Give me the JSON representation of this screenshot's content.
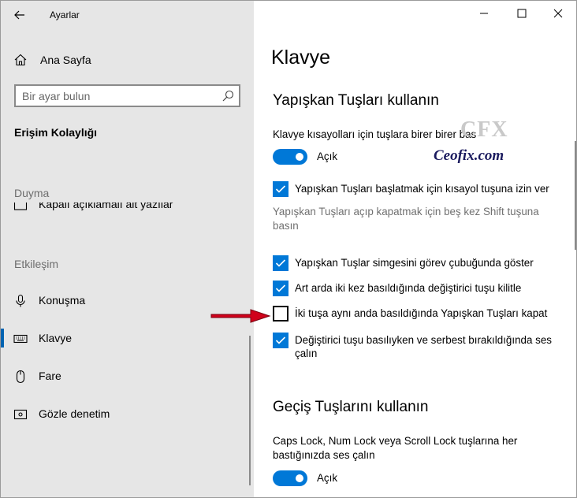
{
  "window": {
    "title": "Ayarlar"
  },
  "sidebar": {
    "home_label": "Ana Sayfa",
    "search_placeholder": "Bir ayar bulun",
    "category": "Erişim Kolaylığı",
    "sections": [
      {
        "label": "Duyma"
      },
      {
        "label": "Etkileşim"
      }
    ],
    "clipped_item": "Kapalı açıklamalı alt yazılar",
    "items": [
      {
        "label": "Konuşma",
        "icon": "microphone-icon"
      },
      {
        "label": "Klavye",
        "icon": "keyboard-icon",
        "active": true
      },
      {
        "label": "Fare",
        "icon": "mouse-icon"
      },
      {
        "label": "Gözle denetim",
        "icon": "eye-control-icon"
      }
    ]
  },
  "main": {
    "page_title": "Klavye",
    "sticky_keys": {
      "heading": "Yapışkan Tuşları kullanın",
      "description": "Klavye kısayolları için tuşlara birer birer bas",
      "toggle_label": "Açık",
      "shortcut_check": "Yapışkan Tuşları başlatmak için kısayol tuşuna izin ver",
      "shortcut_help": "Yapışkan Tuşları açıp kapatmak için beş kez Shift tuşuna basın",
      "options": [
        {
          "label": "Yapışkan Tuşlar simgesini görev çubuğunda göster",
          "checked": true
        },
        {
          "label": "Art arda iki kez basıldığında değiştirici tuşu kilitle",
          "checked": true
        },
        {
          "label": "İki tuşa aynı anda basıldığında Yapışkan Tuşları kapat",
          "checked": false
        },
        {
          "label": "Değiştirici tuşu basılıyken ve serbest bırakıldığında ses çalın",
          "checked": true
        }
      ]
    },
    "toggle_keys": {
      "heading": "Geçiş Tuşlarını kullanın",
      "description": "Caps Lock, Num Lock veya Scroll Lock tuşlarına her bastığınızda ses çalın",
      "toggle_label": "Açık"
    }
  },
  "watermark": {
    "top": "CFX",
    "bottom": "Ceofix.com"
  },
  "colors": {
    "accent": "#0078d7",
    "sidebar_bg": "#e6e6e6",
    "arrow": "#d0021b"
  }
}
